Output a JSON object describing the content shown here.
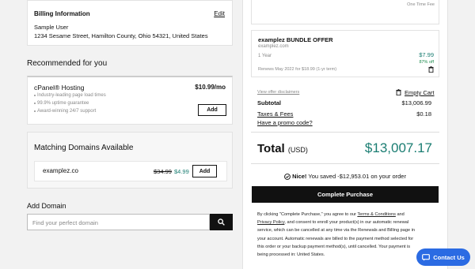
{
  "billing": {
    "title": "Billing Information",
    "edit_label": "Edit",
    "name": "Sample User",
    "address": "1234 Sesame Street, Hamilton County, Ohio 54321, United States"
  },
  "recommended": {
    "heading": "Recommended for you",
    "product": {
      "name": "cPanel® Hosting",
      "price": "$10.99/mo",
      "features": [
        "Industry-leading page load times",
        "99.9% uptime guarantee",
        "Award-winning 24/7 support"
      ],
      "add_label": "Add"
    }
  },
  "domains": {
    "heading": "Matching Domains Available",
    "item": {
      "name": "examplez.co",
      "old_price": "$34.99",
      "new_price": "$4.99",
      "add_label": "Add"
    }
  },
  "add_domain": {
    "heading": "Add Domain",
    "placeholder": "Find your perfect domain"
  },
  "cart": {
    "top_item_note": "One Time Fee",
    "bundle": {
      "title": "examplez BUNDLE OFFER",
      "domain": "examplez.com",
      "term": "1 Year",
      "price": "$7.99",
      "discount": "87% off",
      "renewal": "Renews May 2022 for $18.99 (1-yr term)"
    },
    "view_disclaimers": "View offer disclaimers",
    "empty_cart": "Empty Cart",
    "subtotal_label": "Subtotal",
    "subtotal_value": "$13,006.99",
    "taxes_label": "Taxes & Fees",
    "taxes_value": "$0.18",
    "promo_label": "Have a promo code?",
    "total_label": "Total",
    "total_currency": "(USD)",
    "total_value": "$13,007.17",
    "savings_bold": "Nice!",
    "savings_text": "You saved -$12,953.01 on your order",
    "complete_label": "Complete Purchase",
    "legal_1": "By clicking \"Complete Purchase,\" you agree to our",
    "legal_terms": "Terms & Conditions",
    "legal_and": "and",
    "legal_privacy": "Privacy Policy",
    "legal_2": ", and consent to enroll your product(s) in our automatic renewal",
    "legal_3": "service, which can be cancelled at any time via the Renewals and Billing page in",
    "legal_4": "your account. Automatic renewals are billed to the payment method selected for",
    "legal_5": "this order or your backup payment method(s), until cancelled. Your payment is",
    "legal_6": "being processed in: United States."
  },
  "contact": {
    "label": "Contact Us"
  },
  "colors": {
    "teal": "#1a7d72",
    "contact_blue": "#2b6be3",
    "dark": "#111111"
  }
}
